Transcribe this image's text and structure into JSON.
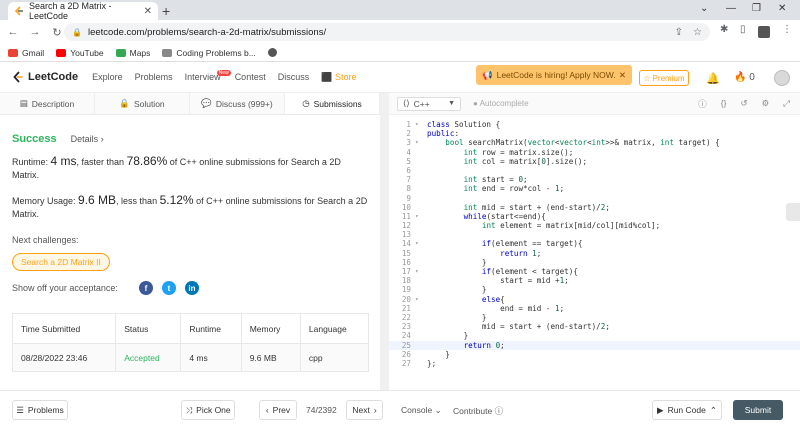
{
  "browser": {
    "tab_title": "Search a 2D Matrix - LeetCode",
    "url": "leetcode.com/problems/search-a-2d-matrix/submissions/",
    "bookmarks": [
      "Gmail",
      "YouTube",
      "Maps",
      "Coding Problems b..."
    ]
  },
  "nav": {
    "logo": "LeetCode",
    "links": [
      "Explore",
      "Problems",
      "Interview",
      "Contest",
      "Discuss",
      "Store"
    ],
    "new_badge": "New",
    "hiring": "LeetCode is hiring! Apply NOW.",
    "premium": "Premium",
    "coins": "0"
  },
  "left_tabs": [
    "Description",
    "Solution",
    "Discuss (999+)",
    "Submissions"
  ],
  "result": {
    "status": "Success",
    "details": "Details",
    "runtime_prefix": "Runtime: ",
    "runtime_value": "4 ms",
    "runtime_mid": ", faster than ",
    "runtime_pct": "78.86%",
    "runtime_suffix": " of C++ online submissions for Search a 2D Matrix.",
    "memory_prefix": "Memory Usage: ",
    "memory_value": "9.6 MB",
    "memory_mid": ", less than ",
    "memory_pct": "5.12%",
    "memory_suffix": " of C++ online submissions for Search a 2D Matrix.",
    "next_label": "Next challenges:",
    "next_chip": "Search a 2D Matrix II",
    "share_label": "Show off your acceptance:"
  },
  "table": {
    "headers": [
      "Time Submitted",
      "Status",
      "Runtime",
      "Memory",
      "Language"
    ],
    "row": [
      "08/28/2022 23:46",
      "Accepted",
      "4 ms",
      "9.6 MB",
      "cpp"
    ]
  },
  "editor": {
    "language": "C++",
    "autocomplete": "Autocomplete",
    "highlighted_line": 25,
    "lines": [
      "class Solution {",
      "public:",
      "    bool searchMatrix(vector<vector<int>>& matrix, int target) {",
      "        int row = matrix.size();",
      "        int col = matrix[0].size();",
      "",
      "        int start = 0;",
      "        int end = row*col - 1;",
      "",
      "        int mid = start + (end-start)/2;",
      "        while(start<=end){",
      "            int element = matrix[mid/col][mid%col];",
      "",
      "            if(element == target){",
      "                return 1;",
      "            }",
      "            if(element < target){",
      "                start = mid +1;",
      "            }",
      "            else{",
      "                end = mid - 1;",
      "            }",
      "            mid = start + (end-start)/2;",
      "        }",
      "        return 0;",
      "    }",
      "};"
    ],
    "fold_lines": [
      1,
      3,
      11,
      14,
      17,
      20
    ]
  },
  "bottom": {
    "problems": "Problems",
    "pick_one": "Pick One",
    "prev": "Prev",
    "page": "74/2392",
    "next": "Next",
    "console": "Console",
    "contribute": "Contribute",
    "run_code": "Run Code",
    "submit": "Submit"
  },
  "colors": {
    "accent": "#ffa116",
    "success": "#2db55d",
    "submit_bg": "#455a64"
  }
}
